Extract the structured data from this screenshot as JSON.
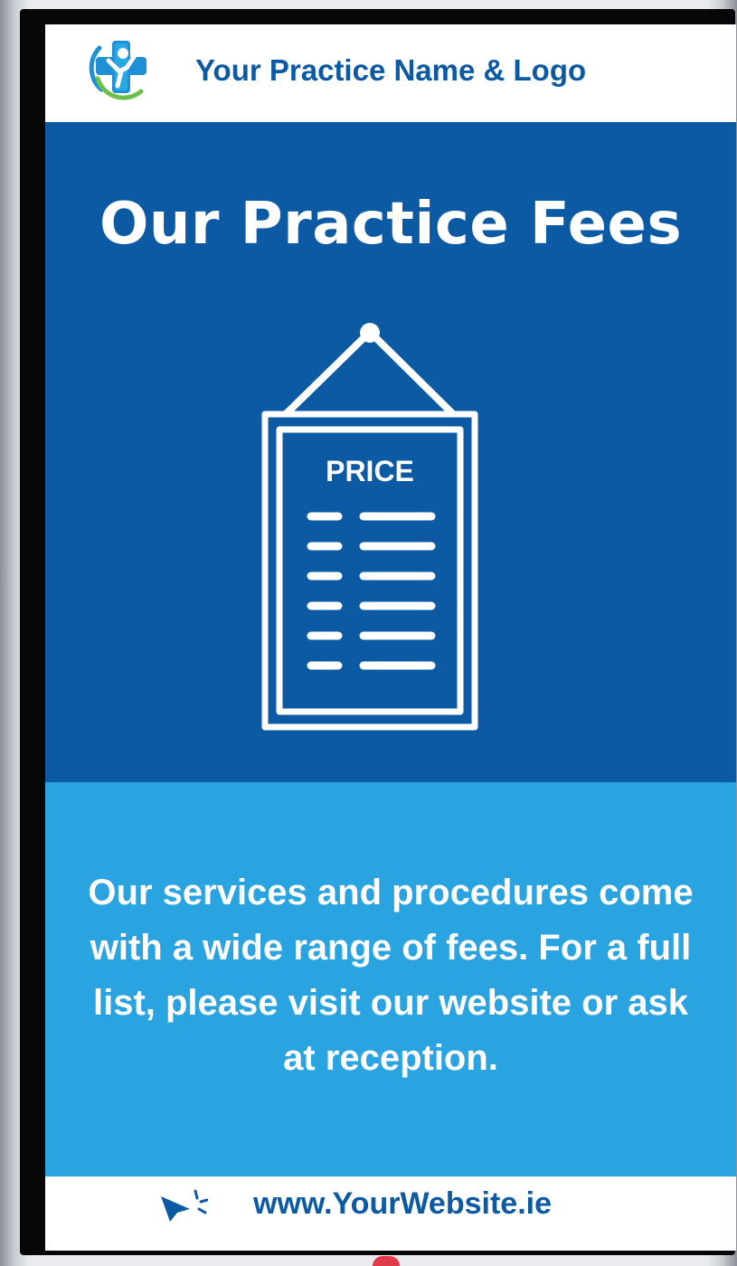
{
  "header": {
    "practice_name": "Your Practice Name & Logo",
    "logo_icon": "medical-cross-person-logo"
  },
  "hero": {
    "title": "Our Practice Fees",
    "sign_icon": "hanging-price-list-icon",
    "sign_label": "PRICE"
  },
  "info": {
    "text": "Our services and procedures come with a wide range of fees. For a full list, please visit our website or ask at reception."
  },
  "footer": {
    "icon": "click-cursor-icon",
    "website": "www.YourWebsite.ie"
  },
  "colors": {
    "dark_blue": "#0b5aa3",
    "light_blue": "#29a4e1",
    "white": "#ffffff",
    "screen_bezel": "#070707"
  }
}
